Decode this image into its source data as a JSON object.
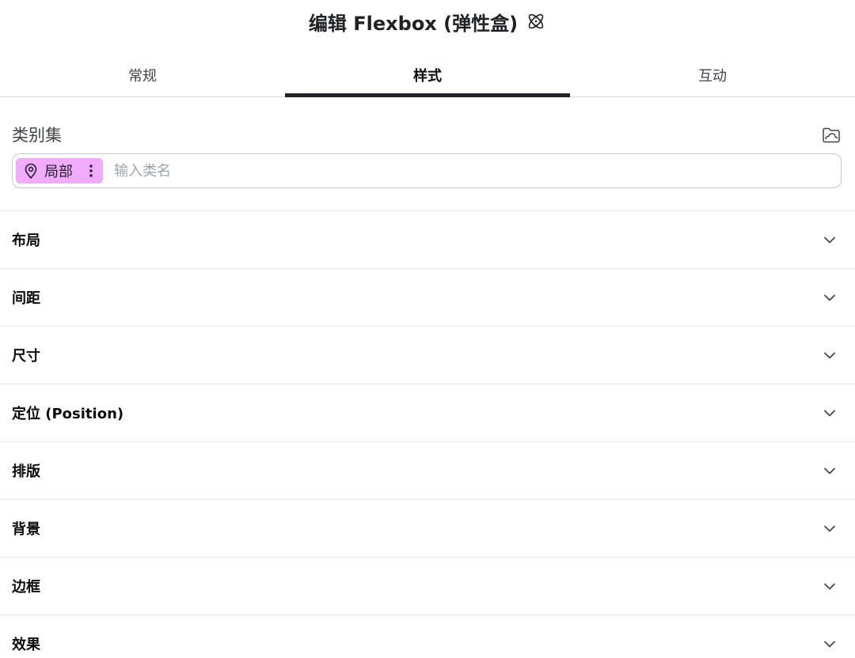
{
  "header": {
    "title": "编辑 Flexbox (弹性盒)",
    "icon": "atom-icon"
  },
  "tabs": [
    {
      "label": "常规",
      "active": false
    },
    {
      "label": "样式",
      "active": true
    },
    {
      "label": "互动",
      "active": false
    }
  ],
  "classes": {
    "label": "类别集",
    "manager_icon": "class-manager-icon",
    "chip": {
      "label": "局部",
      "color": "#f0abfc",
      "icon": "location-pin-icon"
    },
    "input_placeholder": "输入类名",
    "input_value": ""
  },
  "sections": [
    {
      "label": "布局"
    },
    {
      "label": "间距"
    },
    {
      "label": "尺寸"
    },
    {
      "label": "定位 (Position)"
    },
    {
      "label": "排版"
    },
    {
      "label": "背景"
    },
    {
      "label": "边框"
    },
    {
      "label": "效果"
    }
  ],
  "colors": {
    "text": "#1f2124",
    "tab_indicator": "#1f2124",
    "chip_bg": "#f0abfc",
    "divider": "#e4e5e6"
  }
}
